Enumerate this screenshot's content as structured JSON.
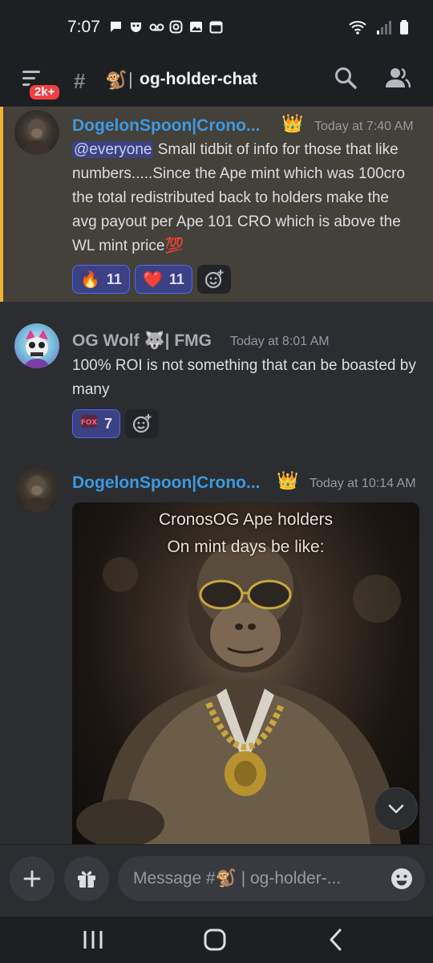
{
  "status_bar": {
    "time": "7:07"
  },
  "header": {
    "mention_badge": "2k+",
    "channel_emoji": "🐒",
    "channel_separator": "|",
    "channel_name": "og-holder-chat"
  },
  "messages": [
    {
      "username": "DogelonSpoon|Crono...",
      "badge": "👑",
      "timestamp": "Today at 7:40 AM",
      "mention": "@everyone",
      "text": " Small tidbit of info for those that like numbers.....Since the Ape mint which was 100cro the total redistributed back to holders make the avg payout per Ape 101 CRO which is above the WL mint price",
      "text_suffix_emoji": "💯",
      "reactions": [
        {
          "emoji": "🔥",
          "count": "11"
        },
        {
          "emoji": "❤️",
          "count": "11"
        }
      ]
    },
    {
      "username": "OG Wolf",
      "username_emoji": "🐺",
      "username_suffix": "| FMG",
      "timestamp": "Today at 8:01 AM",
      "text": "100% ROI is not something that can be boasted by many",
      "reactions": [
        {
          "emoji": "FOX",
          "count": "7"
        }
      ]
    },
    {
      "username": "DogelonSpoon|Crono...",
      "badge": "👑",
      "timestamp": "Today at 10:14 AM",
      "image_caption_line1": "CronosOG Ape holders",
      "image_caption_line2": "On mint days be like:"
    }
  ],
  "composer": {
    "placeholder": "Message #🐒 | og-holder-..."
  },
  "colors": {
    "background": "#2b2d31",
    "header_bg": "#1e1f22",
    "mention_highlight_border": "#f0b232",
    "username_blue": "#3c9ae0",
    "reaction_bg": "#3b4283",
    "badge_red": "#f23f43"
  },
  "icons": [
    "menu-icon",
    "hashtag-icon",
    "search-icon",
    "members-icon",
    "add-reaction-icon",
    "plus-icon",
    "gift-icon",
    "emoji-icon",
    "chevron-down-icon",
    "recents-icon",
    "home-icon",
    "back-icon"
  ]
}
